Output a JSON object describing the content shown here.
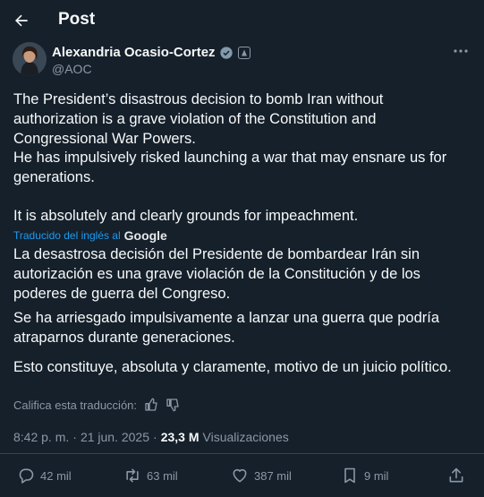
{
  "header": {
    "title": "Post"
  },
  "author": {
    "name": "Alexandria Ocasio-Cortez",
    "handle": "@AOC"
  },
  "tweet": {
    "p1": "The President’s disastrous decision to bomb Iran without authorization is a grave violation of the Constitution and Congressional War Powers.",
    "p2": "He has impulsively risked launching a war that may ensnare us for generations.",
    "p3": "It is absolutely and clearly grounds for impeachment."
  },
  "translation": {
    "label": "Traducido del inglés al",
    "provider": "Google",
    "p1": "La desastrosa decisión del Presidente de bombardear Irán sin autorización es una grave violación de la Constitución y de los poderes de guerra del Congreso.",
    "p2": "Se ha arriesgado impulsivamente a lanzar una guerra que podría atraparnos durante generaciones.",
    "p3": "Esto constituye, absoluta y claramente, motivo de un juicio político.",
    "rate": "Califica esta traducción:"
  },
  "meta": {
    "time": "8:42 p. m.",
    "sep": "·",
    "date": "21 jun. 2025",
    "views_count": "23,3 M",
    "views_label": "Visualizaciones"
  },
  "actions": {
    "replies": "42 mil",
    "reposts": "63 mil",
    "likes": "387 mil",
    "bookmarks": "9 mil"
  },
  "colors": {
    "background": "#15202b",
    "accent": "#1d9bf0",
    "muted": "#8b98a5"
  }
}
